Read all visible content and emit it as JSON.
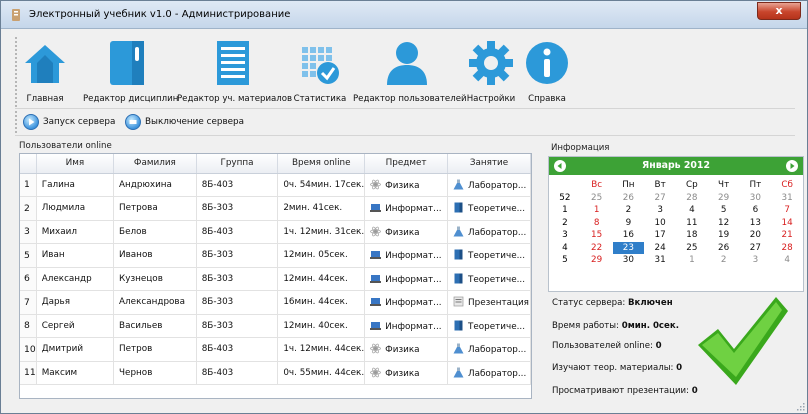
{
  "window": {
    "title": "Электронный учебник v1.0 - Администрирование",
    "close_label": "x"
  },
  "toolbar": {
    "items": [
      {
        "label": "Главная",
        "icon": "home-icon"
      },
      {
        "label": "Редактор дисциплин",
        "icon": "book-icon"
      },
      {
        "label": "Редактор уч. материалов",
        "icon": "document-icon"
      },
      {
        "label": "Статистика",
        "icon": "statistics-icon"
      },
      {
        "label": "Редактор пользователей",
        "icon": "user-icon"
      },
      {
        "label": "Настройки",
        "icon": "gear-icon"
      },
      {
        "label": "Справка",
        "icon": "info-icon"
      }
    ]
  },
  "server": {
    "start_label": "Запуск сервера",
    "stop_label": "Выключение сервера"
  },
  "users": {
    "group_label": "Пользователи online",
    "columns": [
      "",
      "Имя",
      "Фамилия",
      "Группа",
      "Время online",
      "Предмет",
      "Занятие"
    ],
    "rows": [
      {
        "n": "1",
        "name": "Галина",
        "surname": "Андрюхина",
        "group": "8Б-403",
        "time": "0ч. 54мин. 17сек.",
        "subject": "Физика",
        "lesson": "Лаборатор..."
      },
      {
        "n": "2",
        "name": "Людмила",
        "surname": "Петрова",
        "group": "8Б-303",
        "time": "2мин. 41сек.",
        "subject": "Информат...",
        "lesson": "Теоретиче..."
      },
      {
        "n": "3",
        "name": "Михаил",
        "surname": "Белов",
        "group": "8Б-403",
        "time": "1ч. 12мин. 31сек.",
        "subject": "Физика",
        "lesson": "Лаборатор..."
      },
      {
        "n": "5",
        "name": "Иван",
        "surname": "Иванов",
        "group": "8Б-303",
        "time": "12мин. 05сек.",
        "subject": "Информат...",
        "lesson": "Теоретиче..."
      },
      {
        "n": "6",
        "name": "Александр",
        "surname": "Кузнецов",
        "group": "8Б-303",
        "time": "12мин. 44сек.",
        "subject": "Информат...",
        "lesson": "Теоретиче..."
      },
      {
        "n": "7",
        "name": "Дарья",
        "surname": "Александрова",
        "group": "8Б-303",
        "time": "16мин. 44сек.",
        "subject": "Информат...",
        "lesson": "Презентация"
      },
      {
        "n": "8",
        "name": "Сергей",
        "surname": "Васильев",
        "group": "8Б-303",
        "time": "12мин. 40сек.",
        "subject": "Информат...",
        "lesson": "Теоретиче..."
      },
      {
        "n": "10",
        "name": "Дмитрий",
        "surname": "Петров",
        "group": "8Б-403",
        "time": "1ч. 12мин. 44сек.",
        "subject": "Физика",
        "lesson": "Лаборатор..."
      },
      {
        "n": "11",
        "name": "Максим",
        "surname": "Чернов",
        "group": "8Б-403",
        "time": "0ч. 55мин. 44сек.",
        "subject": "Физика",
        "lesson": "Лаборатор..."
      }
    ]
  },
  "info": {
    "group_label": "Информация",
    "calendar": {
      "month_label": "Январь 2012",
      "weekdays": [
        "",
        "Вс",
        "Пн",
        "Вт",
        "Ср",
        "Чт",
        "Пт",
        "Сб"
      ],
      "weeks": [
        [
          "52",
          "25",
          "26",
          "27",
          "28",
          "29",
          "30",
          "31"
        ],
        [
          "1",
          "1",
          "2",
          "3",
          "4",
          "5",
          "6",
          "7"
        ],
        [
          "2",
          "8",
          "9",
          "10",
          "11",
          "12",
          "13",
          "14"
        ],
        [
          "3",
          "15",
          "16",
          "17",
          "18",
          "19",
          "20",
          "21"
        ],
        [
          "4",
          "22",
          "23",
          "24",
          "25",
          "26",
          "27",
          "28"
        ],
        [
          "5",
          "29",
          "30",
          "31",
          "1",
          "2",
          "3",
          "4"
        ]
      ],
      "selected_day": "23"
    },
    "status_label": "Статус сервера:",
    "status_value": "Включен",
    "uptime_label": "Время работы:",
    "uptime_value": "0мин. 0сек.",
    "online_label": "Пользователей online:",
    "online_value": "0",
    "theory_label": "Изучают теор. материалы:",
    "theory_value": "0",
    "present_label": "Просматривают презентации:",
    "present_value": "0"
  },
  "colors": {
    "accent": "#2f94d6",
    "calendar_header": "#3da236",
    "check": "#39b21d",
    "weekend": "#d81e1e"
  }
}
